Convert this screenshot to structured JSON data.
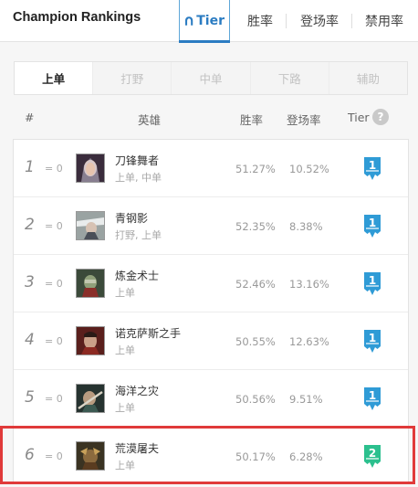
{
  "header": {
    "title": "Champion Rankings",
    "tabs": [
      {
        "label": "Tier",
        "icon": "tier-shield-icon",
        "active": true
      },
      {
        "label": "胜率"
      },
      {
        "label": "登场率"
      },
      {
        "label": "禁用率"
      }
    ]
  },
  "roles": [
    {
      "label": "上单",
      "active": true
    },
    {
      "label": "打野"
    },
    {
      "label": "中单"
    },
    {
      "label": "下路"
    },
    {
      "label": "辅助"
    }
  ],
  "columns": {
    "rank": "#",
    "hero": "英雄",
    "win_rate": "胜率",
    "pick_rate": "登场率",
    "tier": "Tier",
    "help_icon": "?"
  },
  "champions": [
    {
      "rank": "1",
      "delta": "= 0",
      "name": "刀锋舞者",
      "positions": "上单, 中单",
      "win_rate": "51.27%",
      "pick_rate": "10.52%",
      "tier": "1"
    },
    {
      "rank": "2",
      "delta": "= 0",
      "name": "青钢影",
      "positions": "打野, 上单",
      "win_rate": "52.35%",
      "pick_rate": "8.38%",
      "tier": "1"
    },
    {
      "rank": "3",
      "delta": "= 0",
      "name": "炼金术士",
      "positions": "上单",
      "win_rate": "52.46%",
      "pick_rate": "13.16%",
      "tier": "1"
    },
    {
      "rank": "4",
      "delta": "= 0",
      "name": "诺克萨斯之手",
      "positions": "上单",
      "win_rate": "50.55%",
      "pick_rate": "12.63%",
      "tier": "1"
    },
    {
      "rank": "5",
      "delta": "= 0",
      "name": "海洋之灾",
      "positions": "上单",
      "win_rate": "50.56%",
      "pick_rate": "9.51%",
      "tier": "1"
    },
    {
      "rank": "6",
      "delta": "= 0",
      "name": "荒漠屠夫",
      "positions": "上单",
      "win_rate": "50.17%",
      "pick_rate": "6.28%",
      "tier": "2"
    }
  ],
  "colors": {
    "tier1": "#2f9bd6",
    "tier2": "#2cc08e",
    "accent": "#2b7cc2",
    "highlight": "#e03a3a"
  }
}
